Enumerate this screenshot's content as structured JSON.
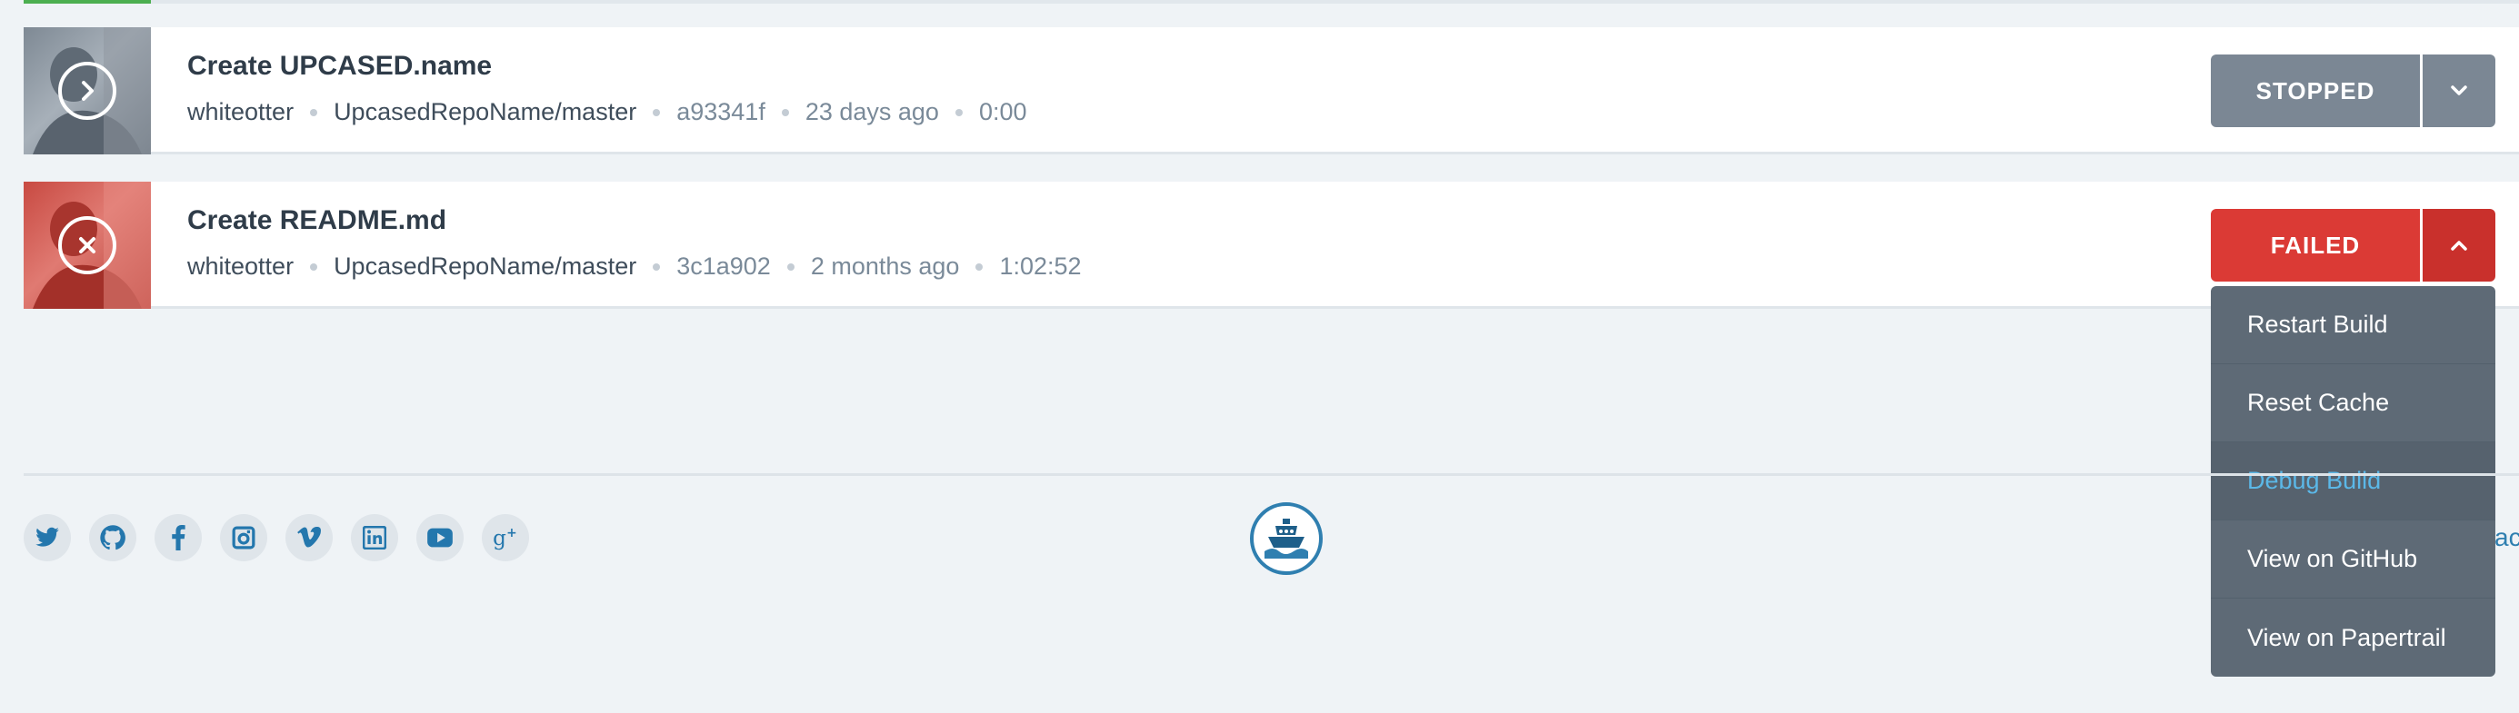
{
  "builds": [
    {
      "title": "Create UPCASED.name",
      "user": "whiteotter",
      "repo_branch": "UpcasedRepoName/master",
      "commit": "a93341f",
      "time_ago": "23 days ago",
      "duration": "0:00",
      "status": "STOPPED",
      "status_color": "#7b8794"
    },
    {
      "title": "Create README.md",
      "user": "whiteotter",
      "repo_branch": "UpcasedRepoName/master",
      "commit": "3c1a902",
      "time_ago": "2 months ago",
      "duration": "1:02:52",
      "status": "FAILED",
      "status_color": "#db3a35"
    }
  ],
  "dropdown": {
    "items": [
      "Restart Build",
      "Reset Cache",
      "Debug Build",
      "View on GitHub",
      "View on Papertrail"
    ],
    "active_item": "Debug Build"
  },
  "footer": {
    "social_icons": [
      "twitter-icon",
      "github-icon",
      "facebook-icon",
      "instagram-icon",
      "vimeo-icon",
      "linkedin-icon",
      "youtube-icon",
      "google-plus-icon"
    ],
    "logo_icon": "ship-icon",
    "cut_link_text": "ac"
  },
  "colors": {
    "background": "#eff3f6",
    "stopped": "#7b8794",
    "failed": "#db3a35",
    "accent": "#2f7fb0",
    "dropdown_bg": "#5e6a76",
    "active_link": "#5bb8e8"
  }
}
